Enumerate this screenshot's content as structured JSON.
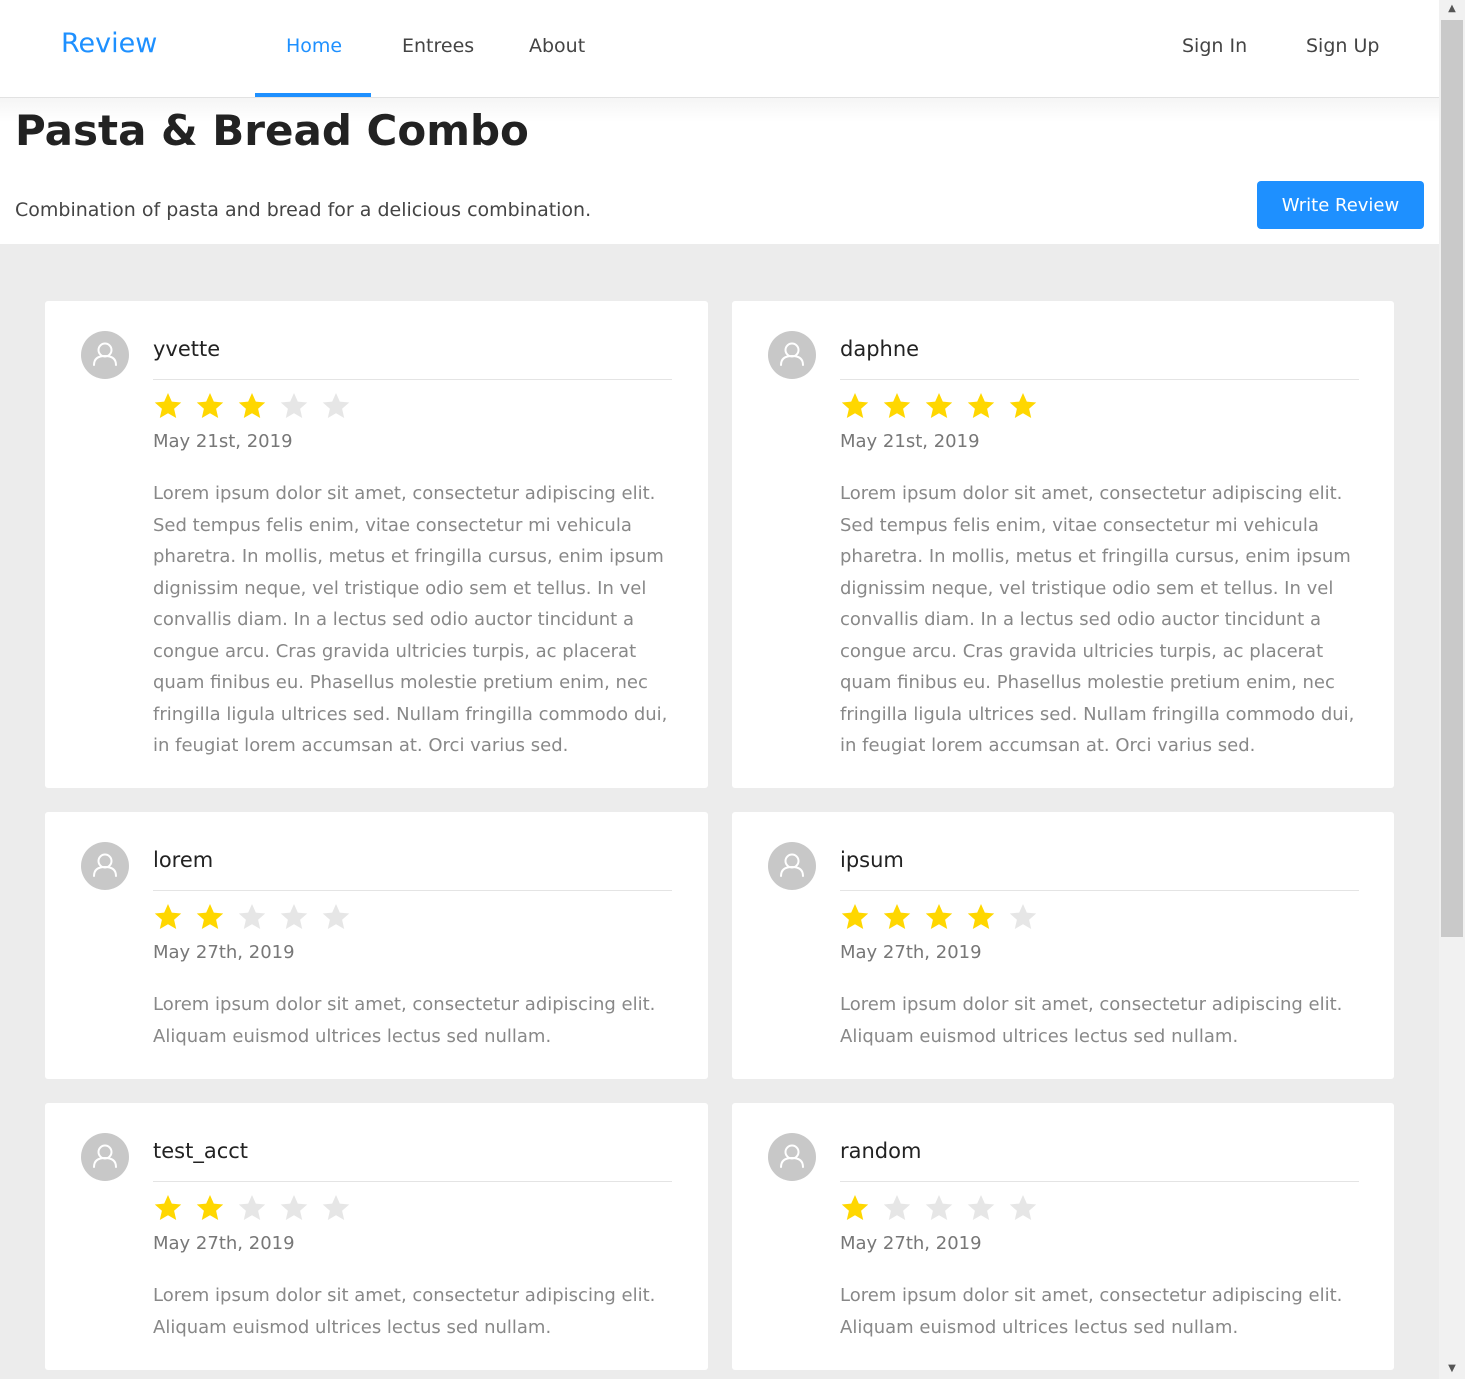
{
  "header": {
    "brand": "Review",
    "nav": [
      {
        "label": "Home",
        "active": true
      },
      {
        "label": "Entrees",
        "active": false
      },
      {
        "label": "About",
        "active": false
      }
    ],
    "auth": {
      "sign_in": "Sign In",
      "sign_up": "Sign Up"
    }
  },
  "hero": {
    "title": "Pasta & Bread Combo",
    "description": "Combination of pasta and bread for a delicious combination.",
    "write_review": "Write Review"
  },
  "colors": {
    "accent": "#1e90ff",
    "star_filled": "#ffd700",
    "star_empty": "#e6e6e6",
    "page_bg": "#ececec"
  },
  "reviews": [
    {
      "author": "yvette",
      "rating": 3,
      "max_rating": 5,
      "date": "May 21st, 2019",
      "text": "Lorem ipsum dolor sit amet, consectetur adipiscing elit. Sed tempus felis enim, vitae consectetur mi vehicula pharetra. In mollis, metus et fringilla cursus, enim ipsum dignissim neque, vel tristique odio sem et tellus. In vel convallis diam. In a lectus sed odio auctor tincidunt a congue arcu. Cras gravida ultricies turpis, ac placerat quam finibus eu. Phasellus molestie pretium enim, nec fringilla ligula ultrices sed. Nullam fringilla commodo dui, in feugiat lorem accumsan at. Orci varius sed."
    },
    {
      "author": "daphne",
      "rating": 5,
      "max_rating": 5,
      "date": "May 21st, 2019",
      "text": "Lorem ipsum dolor sit amet, consectetur adipiscing elit. Sed tempus felis enim, vitae consectetur mi vehicula pharetra. In mollis, metus et fringilla cursus, enim ipsum dignissim neque, vel tristique odio sem et tellus. In vel convallis diam. In a lectus sed odio auctor tincidunt a congue arcu. Cras gravida ultricies turpis, ac placerat quam finibus eu. Phasellus molestie pretium enim, nec fringilla ligula ultrices sed. Nullam fringilla commodo dui, in feugiat lorem accumsan at. Orci varius sed."
    },
    {
      "author": "lorem",
      "rating": 2,
      "max_rating": 5,
      "date": "May 27th, 2019",
      "text": "Lorem ipsum dolor sit amet, consectetur adipiscing elit. Aliquam euismod ultrices lectus sed nullam."
    },
    {
      "author": "ipsum",
      "rating": 4,
      "max_rating": 5,
      "date": "May 27th, 2019",
      "text": "Lorem ipsum dolor sit amet, consectetur adipiscing elit. Aliquam euismod ultrices lectus sed nullam."
    },
    {
      "author": "test_acct",
      "rating": 2,
      "max_rating": 5,
      "date": "May 27th, 2019",
      "text": "Lorem ipsum dolor sit amet, consectetur adipiscing elit. Aliquam euismod ultrices lectus sed nullam."
    },
    {
      "author": "random",
      "rating": 1,
      "max_rating": 5,
      "date": "May 27th, 2019",
      "text": "Lorem ipsum dolor sit amet, consectetur adipiscing elit. Aliquam euismod ultrices lectus sed nullam."
    }
  ]
}
